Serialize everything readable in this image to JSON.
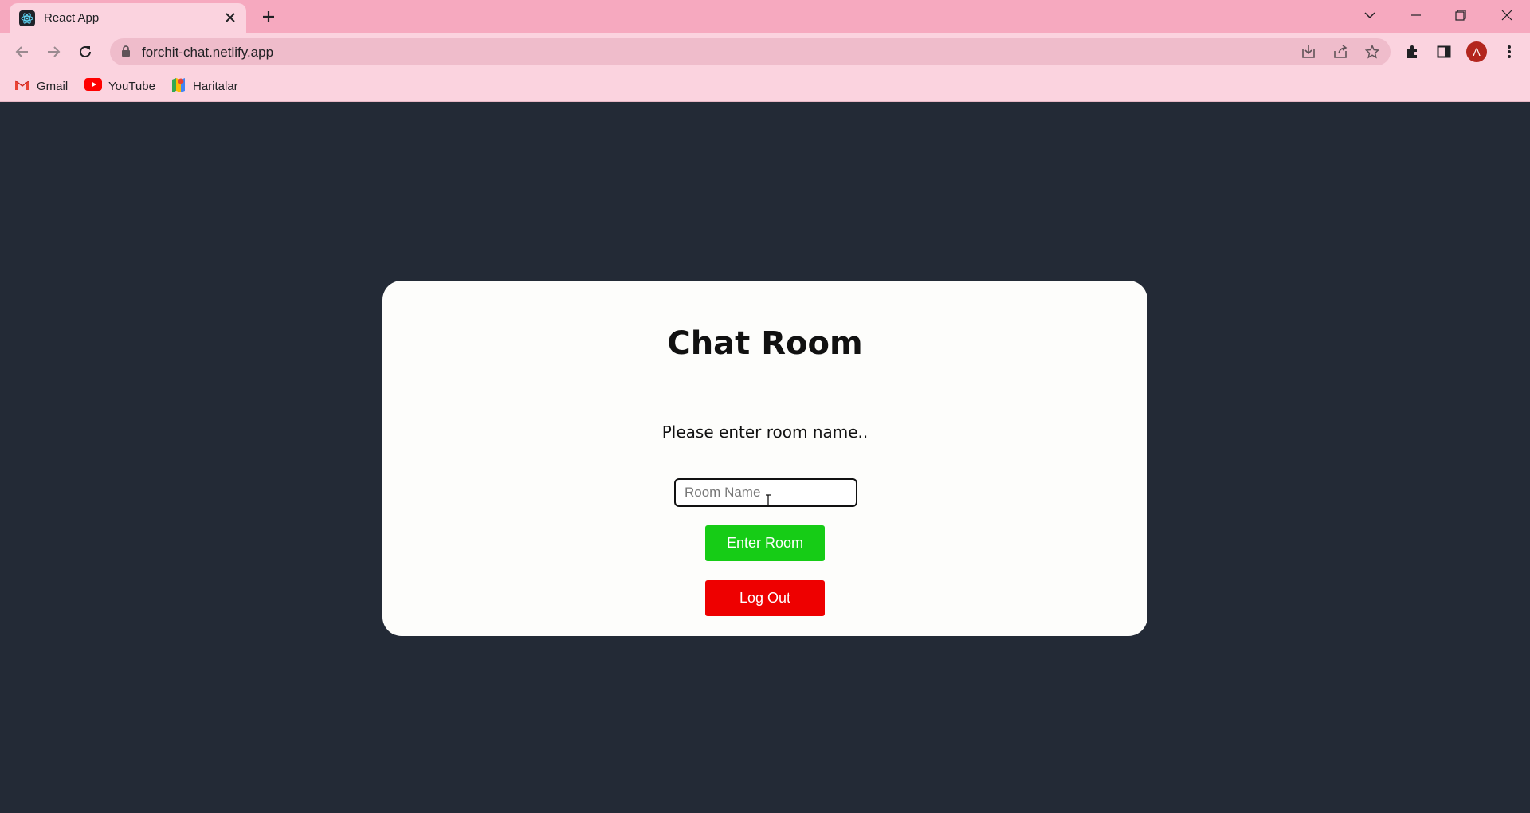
{
  "browser": {
    "tab": {
      "title": "React App",
      "favicon": "react-logo"
    },
    "url": "forchit-chat.netlify.app",
    "avatar_initial": "A",
    "bookmarks": [
      {
        "label": "Gmail",
        "icon": "gmail-icon"
      },
      {
        "label": "YouTube",
        "icon": "youtube-icon"
      },
      {
        "label": "Haritalar",
        "icon": "maps-icon"
      }
    ],
    "colors": {
      "tabstrip": "#f6a9bf",
      "toolbar": "#fbd3df"
    }
  },
  "page": {
    "title": "Chat Room",
    "prompt": "Please enter room name..",
    "room_input": {
      "placeholder": "Room Name",
      "value": ""
    },
    "enter_button": "Enter Room",
    "logout_button": "Log Out",
    "colors": {
      "background": "#232a36",
      "card": "#fdfdfb",
      "enter": "#16cc16",
      "logout": "#ee0000"
    }
  }
}
